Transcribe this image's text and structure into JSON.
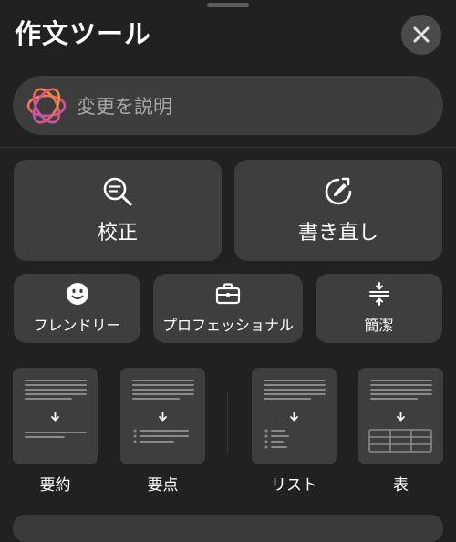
{
  "header": {
    "title": "作文ツール",
    "close_icon": "close-icon"
  },
  "describe": {
    "placeholder": "変更を説明",
    "icon": "apple-intelligence-icon"
  },
  "actions": {
    "proofread": {
      "label": "校正",
      "icon": "magnifier-text-icon"
    },
    "rewrite": {
      "label": "書き直し",
      "icon": "rewrite-icon"
    }
  },
  "tones": {
    "friendly": {
      "label": "フレンドリー",
      "icon": "smiley-icon"
    },
    "professional": {
      "label": "プロフェッショナル",
      "icon": "briefcase-icon"
    },
    "concise": {
      "label": "簡潔",
      "icon": "compress-icon"
    }
  },
  "formats": {
    "summary": {
      "label": "要約"
    },
    "key_points": {
      "label": "要点"
    },
    "list": {
      "label": "リスト"
    },
    "table": {
      "label": "表"
    }
  },
  "colors": {
    "background": "#212121",
    "button": "#3e3e3e",
    "text": "#ffffff",
    "placeholder": "#a8a8a8"
  }
}
